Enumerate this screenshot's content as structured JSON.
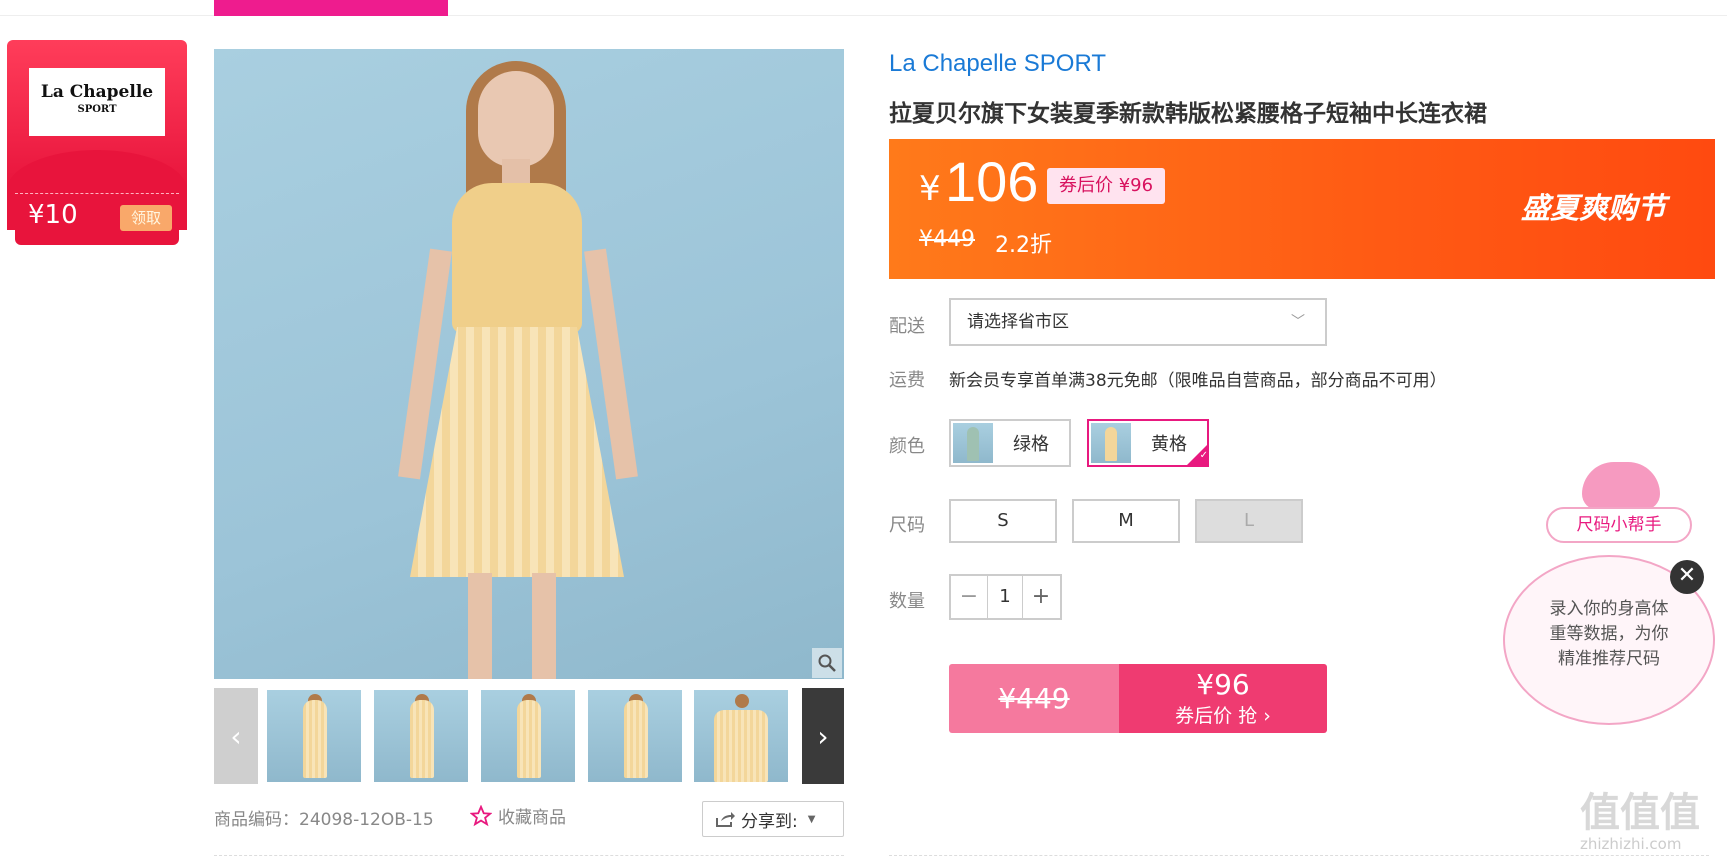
{
  "coupon": {
    "logo_line1": "La Chapelle",
    "logo_line2": "SPORT",
    "amount": "¥10",
    "take_label": "领取"
  },
  "product": {
    "brand": "La Chapelle SPORT",
    "title": "拉夏贝尔旗下女装夏季新款韩版松紧腰格子短袖中长连衣裙",
    "currency": "¥",
    "price": "106",
    "after_coupon": "券后价 ¥96",
    "original_price": "¥449",
    "discount": "2.2折",
    "festival": "盛夏爽购节",
    "code_label": "商品编码：24098-12OB-15",
    "favorite_label": "收藏商品",
    "share_label": "分享到:"
  },
  "labels": {
    "delivery": "配送",
    "shipping": "运费",
    "color": "颜色",
    "size": "尺码",
    "quantity": "数量"
  },
  "delivery": {
    "placeholder": "请选择省市区"
  },
  "shipping_text": "新会员专享首单满38元免邮（限唯品自营商品，部分商品不可用）",
  "colors": [
    {
      "label": "绿格",
      "selected": false,
      "swatch": "#9fc1b2"
    },
    {
      "label": "黄格",
      "selected": true,
      "swatch": "#f3d69a"
    }
  ],
  "sizes": [
    {
      "label": "S",
      "disabled": false
    },
    {
      "label": "M",
      "disabled": false
    },
    {
      "label": "L",
      "disabled": true
    }
  ],
  "quantity": {
    "value": "1",
    "minus": "−",
    "plus": "+"
  },
  "buy": {
    "old_price": "¥449",
    "new_price": "¥96",
    "cta": "券后价 抢 ›"
  },
  "helper": {
    "tag": "尺码小帮手",
    "text": "录入你的身高体重等数据，为你精准推荐尺码",
    "close": "✕"
  },
  "watermark": {
    "main": "值值值",
    "sub": "zhizhizhi.com"
  },
  "colors_theme": {
    "accent": "#ee1c8e",
    "price_bg": "#ff5a14",
    "brand_blue": "#1a7ad6",
    "buy_pink": "#ef3b71"
  }
}
